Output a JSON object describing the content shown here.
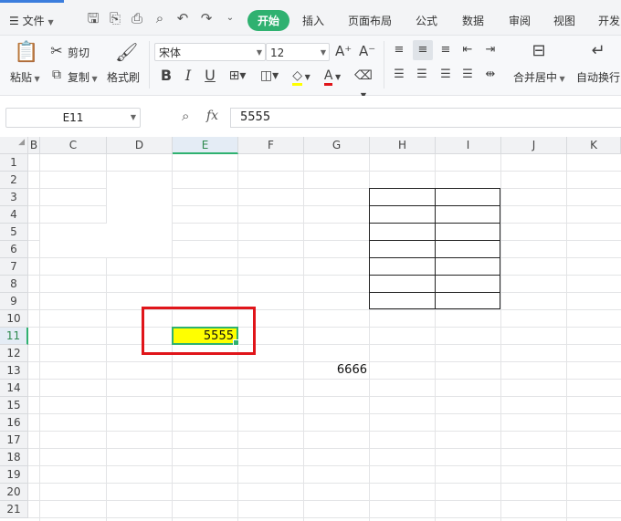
{
  "menu": {
    "file_label": "文件"
  },
  "tabs": [
    {
      "label": "开始",
      "active": true
    },
    {
      "label": "插入"
    },
    {
      "label": "页面布局"
    },
    {
      "label": "公式"
    },
    {
      "label": "数据"
    },
    {
      "label": "审阅"
    },
    {
      "label": "视图"
    },
    {
      "label": "开发"
    }
  ],
  "ribbon": {
    "paste": "粘贴",
    "cut": "剪切",
    "copy": "复制",
    "format_painter": "格式刷",
    "font_name": "宋体",
    "font_size": "12",
    "merge_center": "合并居中",
    "wrap_text": "自动换行"
  },
  "formula_bar": {
    "cell_ref": "E11",
    "fx": "fx",
    "value": "5555"
  },
  "grid": {
    "columns": [
      "B",
      "C",
      "D",
      "E",
      "F",
      "G",
      "H",
      "I",
      "J",
      "K"
    ],
    "selected_column": "E",
    "rows": [
      "1",
      "2",
      "3",
      "4",
      "5",
      "6",
      "7",
      "8",
      "9",
      "10",
      "11",
      "12",
      "13",
      "14",
      "15",
      "16",
      "17",
      "18",
      "19",
      "20",
      "21"
    ],
    "selected_row": "11",
    "cells": {
      "E11": "5555",
      "G13": "6666"
    }
  },
  "colors": {
    "accent": "#2fb170",
    "highlight_fill": "#ffff00",
    "annotation_box": "#e0151a"
  }
}
